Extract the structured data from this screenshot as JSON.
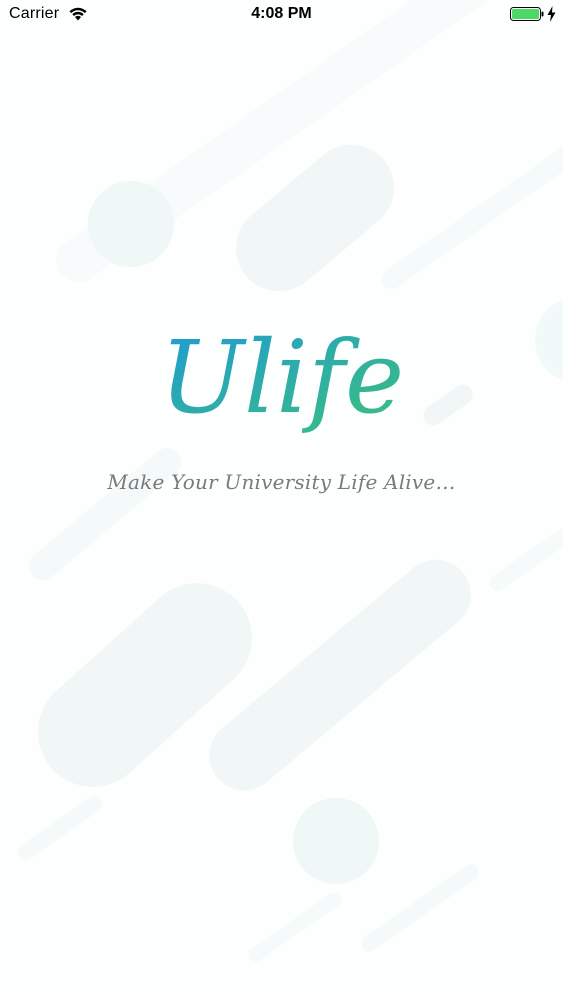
{
  "status_bar": {
    "carrier": "Carrier",
    "time": "4:08 PM",
    "icons": [
      "wifi-icon",
      "battery-icon",
      "charging-bolt-icon"
    ],
    "battery_color": "#4cd964"
  },
  "splash": {
    "logo_text": "Ulife",
    "tagline": "Make Your University Life Alive…",
    "logo_gradient": [
      "#1f9ad6",
      "#3cc07a"
    ]
  },
  "colors": {
    "background": "#fdfefe",
    "decor": "#eef6f6",
    "tagline": "#7a7a7a"
  }
}
